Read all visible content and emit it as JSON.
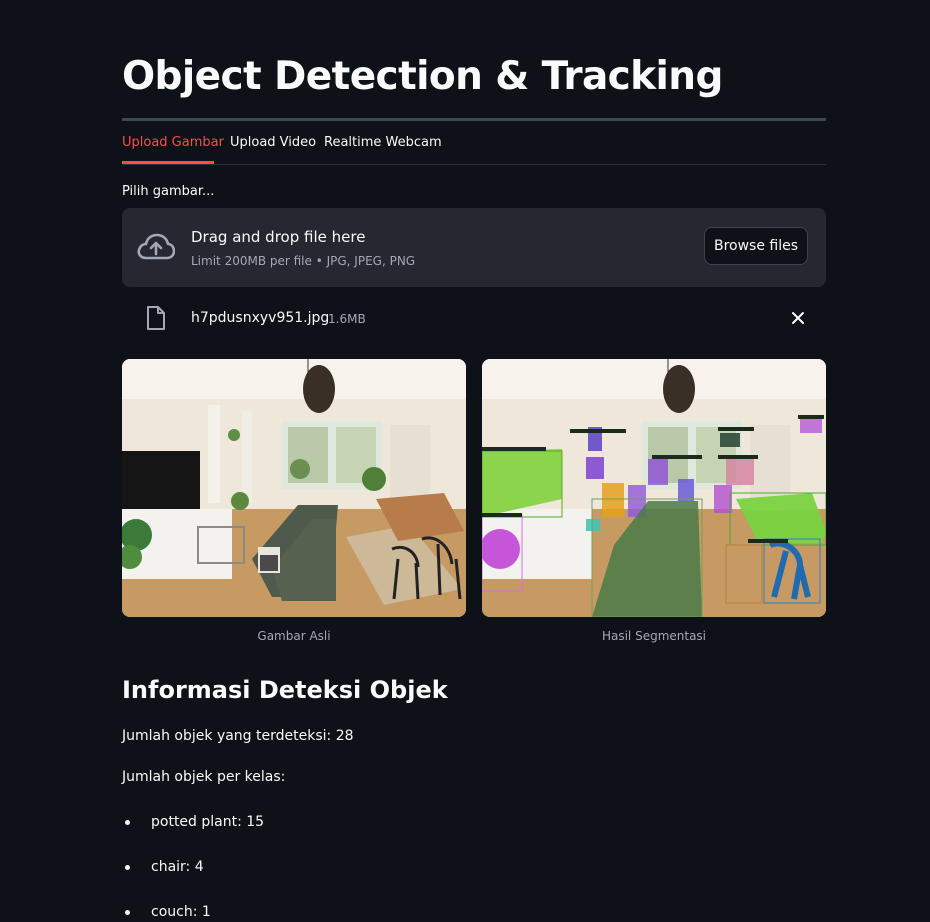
{
  "header": {
    "title": "Object Detection & Tracking"
  },
  "tabs": [
    {
      "label": "Upload Gambar",
      "active": true
    },
    {
      "label": "Upload Video",
      "active": false
    },
    {
      "label": "Realtime Webcam",
      "active": false
    }
  ],
  "uploader": {
    "label": "Pilih gambar...",
    "drop_text": "Drag and drop file here",
    "limit_text": "Limit 200MB per file • JPG, JPEG, PNG",
    "browse_label": "Browse files",
    "icon": "cloud-upload-icon"
  },
  "uploaded_file": {
    "name": "h7pdusnxyv951.jpg",
    "size": "1.6MB",
    "icon": "file-icon",
    "remove_icon": "close-icon"
  },
  "images": {
    "original_caption": "Gambar Asli",
    "segmented_caption": "Hasil Segmentasi"
  },
  "info": {
    "heading": "Informasi Deteksi Objek",
    "total_text": "Jumlah objek yang terdeteksi: 28",
    "per_class_text": "Jumlah objek per kelas:",
    "classes": [
      "potted plant: 15",
      "chair: 4",
      "couch: 1"
    ]
  },
  "colors": {
    "background": "#0e1117",
    "accent": "#ff4b4b",
    "panel": "#262730",
    "muted_text": "#a3a8b8"
  }
}
